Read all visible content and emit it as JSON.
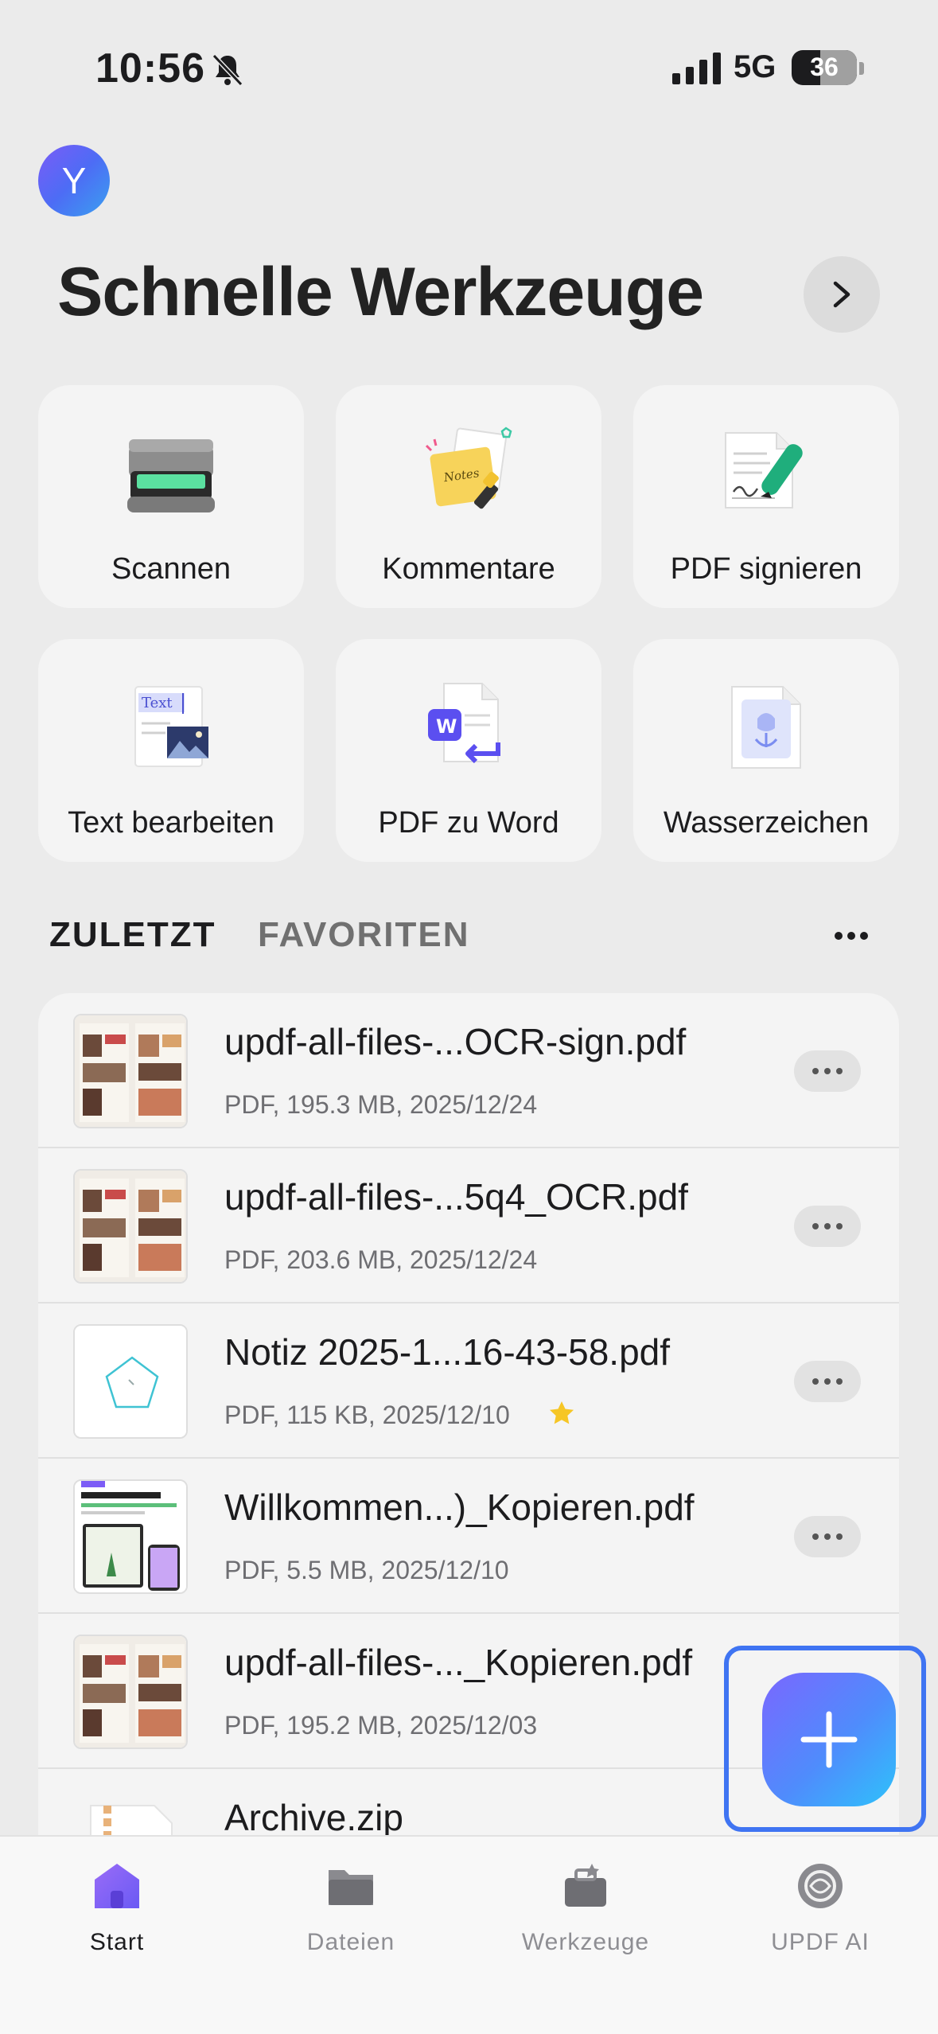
{
  "status_bar": {
    "time": "10:56",
    "network": "5G",
    "battery": "36"
  },
  "avatar": {
    "initial": "Y"
  },
  "section_title": "Schnelle Werkzeuge",
  "tools": [
    {
      "label": "Scannen",
      "icon": "scanner-icon"
    },
    {
      "label": "Kommentare",
      "icon": "notes-icon"
    },
    {
      "label": "PDF signieren",
      "icon": "sign-icon"
    },
    {
      "label": "Text bearbeiten",
      "icon": "edit-text-icon"
    },
    {
      "label": "PDF zu Word",
      "icon": "pdf-to-word-icon"
    },
    {
      "label": "Wasserzeichen",
      "icon": "watermark-icon"
    }
  ],
  "tabs": {
    "active": "ZULETZT",
    "inactive": "FAVORITEN"
  },
  "files": [
    {
      "name": "updf-all-files-...OCR-sign.pdf",
      "meta": "PDF, 195.3 MB, 2025/12/24",
      "thumb": "magazine",
      "starred": false
    },
    {
      "name": "updf-all-files-...5q4_OCR.pdf",
      "meta": "PDF, 203.6 MB, 2025/12/24",
      "thumb": "magazine",
      "starred": false
    },
    {
      "name": "Notiz 2025-1...16-43-58.pdf",
      "meta": "PDF, 115 KB, 2025/12/10",
      "thumb": "pentagon",
      "starred": true
    },
    {
      "name": "Willkommen...)_Kopieren.pdf",
      "meta": "PDF, 5.5 MB, 2025/12/10",
      "thumb": "welcome",
      "starred": false
    },
    {
      "name": "updf-all-files-..._Kopieren.pdf",
      "meta": "PDF, 195.2 MB, 2025/12/03",
      "thumb": "magazine",
      "starred": false
    },
    {
      "name": "Archive.zip",
      "meta": "",
      "thumb": "zip",
      "starred": false
    }
  ],
  "bottom_tabs": [
    {
      "label": "Start",
      "icon": "home-icon",
      "active": true
    },
    {
      "label": "Dateien",
      "icon": "folder-icon",
      "active": false
    },
    {
      "label": "Werkzeuge",
      "icon": "toolbox-icon",
      "active": false
    },
    {
      "label": "UPDF AI",
      "icon": "ai-icon",
      "active": false
    }
  ],
  "colors": {
    "accent": "#3f74f2",
    "fab_start": "#7a67ff",
    "fab_end": "#2ec2fb",
    "active_tab": "#7c5cf6"
  }
}
